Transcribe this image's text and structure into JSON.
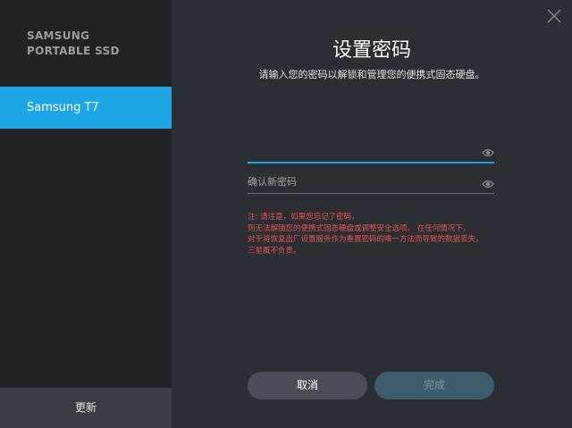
{
  "sidebar": {
    "brand_line1": "SAMSUNG",
    "brand_line2": "PORTABLE SSD",
    "device": "Samsung T7",
    "update_label": "更新"
  },
  "dialog": {
    "title": "设置密码",
    "subtitle": "请输入您的密码以解锁和管理您的便携式固态硬盘。",
    "password_value": "",
    "confirm_placeholder": "确认新密码",
    "note_lines": [
      "注: 请注意，如果您忘记了密码，",
      "则无法解锁您的便携式固态硬盘或调整安全选项。 在任何情况下，",
      "对于将恢复出厂设置服务作为重置密码的唯一方法而导致的数据丢失，",
      "三星概不负责。"
    ],
    "cancel_label": "取消",
    "done_label": "完成"
  },
  "icons": {
    "close": "close-icon",
    "eye": "eye-icon"
  },
  "colors": {
    "accent": "#1ea5e5",
    "sidebar_bg": "#202225",
    "main_bg": "#2b2e33",
    "warning": "#e8524f"
  }
}
